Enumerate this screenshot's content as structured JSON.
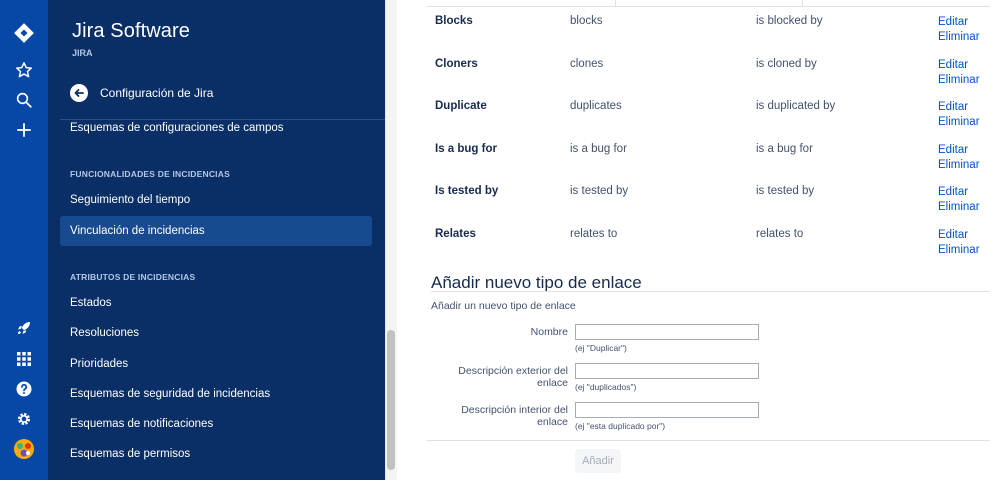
{
  "global_nav": {
    "icons": [
      "jira-logo-icon",
      "star-icon",
      "search-icon",
      "plus-icon",
      "rocket-icon",
      "app-grid-icon",
      "help-icon",
      "settings-icon",
      "user-avatar-icon"
    ]
  },
  "sidebar": {
    "product_title": "Jira Software",
    "product_subtitle": "JIRA",
    "back_label": "Configuración de Jira",
    "items_top": [
      {
        "label": "Esquemas de configuraciones de campos"
      }
    ],
    "heading_1": "FUNCIONALIDADES DE INCIDENCIAS",
    "items_section1": [
      {
        "label": "Seguimiento del tiempo",
        "selected": false
      },
      {
        "label": "Vinculación de incidencias",
        "selected": true
      }
    ],
    "heading_2": "ATRIBUTOS DE INCIDENCIAS",
    "items_section2": [
      {
        "label": "Estados"
      },
      {
        "label": "Resoluciones"
      },
      {
        "label": "Prioridades"
      },
      {
        "label": "Esquemas de seguridad de incidencias"
      },
      {
        "label": "Esquemas de notificaciones"
      },
      {
        "label": "Esquemas de permisos"
      }
    ]
  },
  "link_types": {
    "rows": [
      {
        "name": "Blocks",
        "outward": "blocks",
        "inward": "is blocked by",
        "edit": "Editar",
        "delete": "Eliminar"
      },
      {
        "name": "Cloners",
        "outward": "clones",
        "inward": "is cloned by",
        "edit": "Editar",
        "delete": "Eliminar"
      },
      {
        "name": "Duplicate",
        "outward": "duplicates",
        "inward": "is duplicated by",
        "edit": "Editar",
        "delete": "Eliminar"
      },
      {
        "name": "Is a bug for",
        "outward": "is a bug for",
        "inward": "is a bug for",
        "edit": "Editar",
        "delete": "Eliminar"
      },
      {
        "name": "Is tested by",
        "outward": "is tested by",
        "inward": "is tested by",
        "edit": "Editar",
        "delete": "Eliminar"
      },
      {
        "name": "Relates",
        "outward": "relates to",
        "inward": "relates to",
        "edit": "Editar",
        "delete": "Eliminar"
      }
    ]
  },
  "add_form": {
    "title": "Añadir nuevo tipo de enlace",
    "description": "Añadir un nuevo tipo de enlace",
    "fields": [
      {
        "label": "Nombre",
        "value": "",
        "hint": "(ej \"Duplicar\")"
      },
      {
        "label": "Descripción exterior del enlace",
        "value": "",
        "hint": "(ej \"duplicados\")"
      },
      {
        "label": "Descripción interior del enlace",
        "value": "",
        "hint": "(ej \"esta duplicado por\")"
      }
    ],
    "submit_label": "Añadir"
  },
  "colors": {
    "global_nav_bg": "#0747a6",
    "sidebar_bg": "#0a2f66",
    "selected_item_bg": "#174a8f",
    "link": "#0052cc",
    "text": "#172b4d"
  }
}
